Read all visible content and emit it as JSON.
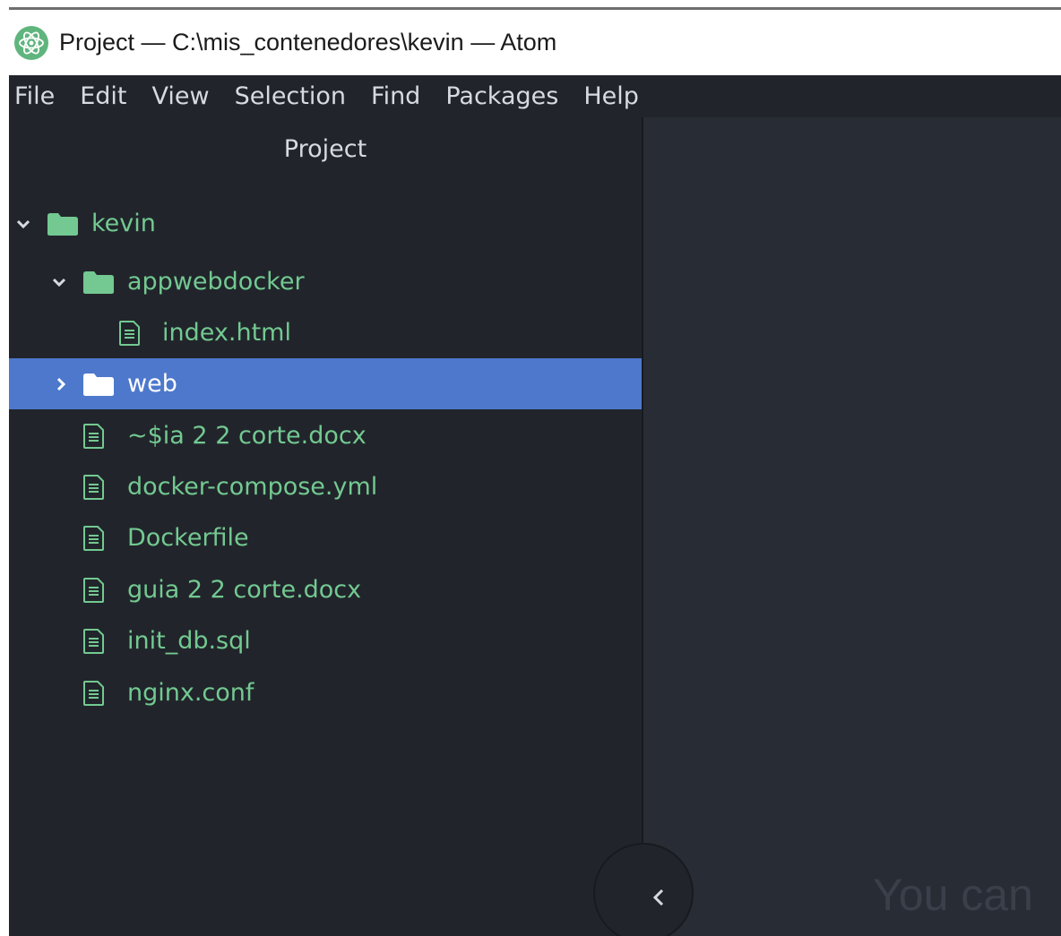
{
  "window": {
    "title": "Project — C:\\mis_contenedores\\kevin — Atom"
  },
  "menu": [
    "File",
    "Edit",
    "View",
    "Selection",
    "Find",
    "Packages",
    "Help"
  ],
  "tree_view": {
    "header": "Project",
    "items": [
      {
        "name": "kevin",
        "type": "folder",
        "expanded": true,
        "depth": 0,
        "selected": false
      },
      {
        "name": "appwebdocker",
        "type": "folder",
        "expanded": true,
        "depth": 1,
        "selected": false
      },
      {
        "name": "index.html",
        "type": "file",
        "depth": 2,
        "selected": false
      },
      {
        "name": "web",
        "type": "folder",
        "expanded": false,
        "depth": 1,
        "selected": true
      },
      {
        "name": "~$ia 2 2 corte.docx",
        "type": "file",
        "depth": 1,
        "selected": false
      },
      {
        "name": "docker-compose.yml",
        "type": "file",
        "depth": 1,
        "selected": false
      },
      {
        "name": "Dockerfile",
        "type": "file",
        "depth": 1,
        "selected": false
      },
      {
        "name": "guia 2 2 corte.docx",
        "type": "file",
        "depth": 1,
        "selected": false
      },
      {
        "name": "init_db.sql",
        "type": "file",
        "depth": 1,
        "selected": false
      },
      {
        "name": "nginx.conf",
        "type": "file",
        "depth": 1,
        "selected": false
      }
    ]
  },
  "editor": {
    "hint": "You can"
  },
  "colors": {
    "background": "#21252b",
    "editor": "#282c34",
    "selection": "#4d78cc",
    "tree_text": "#73c991",
    "menu_text": "#d7dae0"
  }
}
